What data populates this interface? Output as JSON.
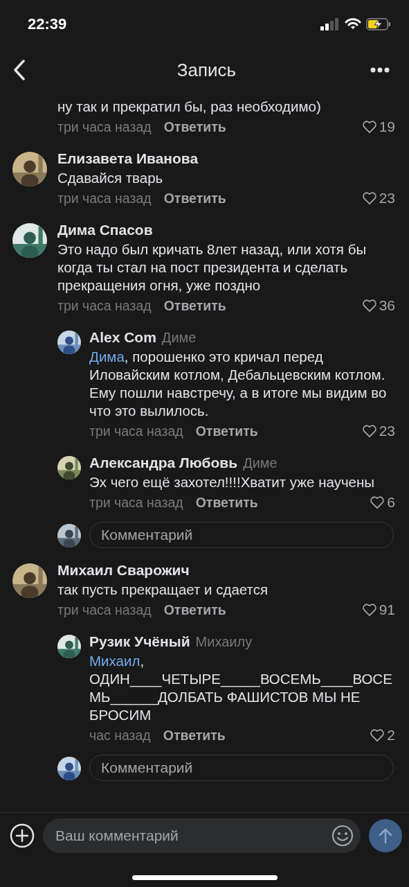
{
  "status_bar": {
    "time": "22:39"
  },
  "header": {
    "title": "Запись"
  },
  "comments": [
    {
      "text": "ну так и прекратил бы, раз необходимо)",
      "time": "три часа назад",
      "reply": "Ответить",
      "likes": "19"
    },
    {
      "author": "Елизавета Иванова",
      "text": "Сдавайся тварь",
      "time": "три часа назад",
      "reply": "Ответить",
      "likes": "23"
    },
    {
      "author": "Дима Спасов",
      "text": "Это надо был кричать 8лет назад, или хотя бы когда ты стал на пост президента и сделать прекращения огня, уже поздно",
      "time": "три часа назад",
      "reply": "Ответить",
      "likes": "36",
      "children": [
        {
          "author": "Alex Com",
          "reply_to": "Диме",
          "mention": "Дима",
          "text": ", порошенко это кричал перед Иловайским котлом, Дебальцевским котлом. Ему пошли навстречу, а в итоге мы видим во что это вылилось.",
          "time": "три часа назад",
          "reply": "Ответить",
          "likes": "23"
        },
        {
          "author": "Александра Любовь",
          "reply_to": "Диме",
          "text": "Эх чего ещё захотел!!!!Хватит уже научены",
          "time": "три часа назад",
          "reply": "Ответить",
          "likes": "6"
        }
      ],
      "reply_field": {
        "placeholder": "Комментарий"
      }
    },
    {
      "author": "Михаил Сварожич",
      "text": "так пусть прекращает и сдается",
      "time": "три часа назад",
      "reply": "Ответить",
      "likes": "91",
      "children": [
        {
          "author": "Рузик Учёный",
          "reply_to": "Михаилу",
          "mention": "Михаил",
          "text": ", ОДИН____ЧЕТЫРЕ_____ВОСЕМЬ____ВОСЕМЬ______ДОЛБАТЬ ФАШИСТОВ МЫ НЕ БРОСИМ",
          "time": "час назад",
          "reply": "Ответить",
          "likes": "2"
        }
      ],
      "reply_field": {
        "placeholder": "Комментарий"
      }
    }
  ],
  "composer": {
    "placeholder": "Ваш комментарий"
  }
}
